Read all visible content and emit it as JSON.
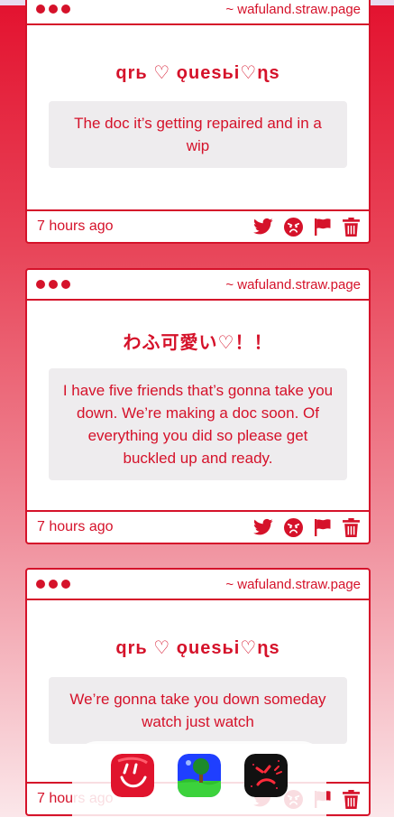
{
  "cards": [
    {
      "host": "~ wafuland.straw.page",
      "title": "qrь ♡ ǫuesьi♡ɳs",
      "message": "The doc it’s getting repaired and in a wip",
      "time": "7 hours ago"
    },
    {
      "host": "~ wafuland.straw.page",
      "title": "わふ可愛い♡！！",
      "message": "I have five friends that’s gonna take you down. We’re making a doc soon. Of everything you did so please get buckled up and ready.",
      "time": "7 hours ago"
    },
    {
      "host": "~ wafuland.straw.page",
      "title": "qrь ♡ ǫuesьi♡ɳs",
      "message": "We’re gonna take you down someday watch just watch",
      "time": "7 hours ago"
    }
  ],
  "icons": {
    "share": "twitter-icon",
    "angry": "angry-face-icon",
    "report": "flag-icon",
    "delete": "trash-icon"
  },
  "dock_apps": [
    {
      "icon": "red-smile-app-icon"
    },
    {
      "icon": "landscape-app-icon"
    },
    {
      "icon": "dark-angry-app-icon"
    }
  ],
  "colors": {
    "accent": "#d5122a",
    "bubble": "#eeecee",
    "card": "#ffffff"
  }
}
